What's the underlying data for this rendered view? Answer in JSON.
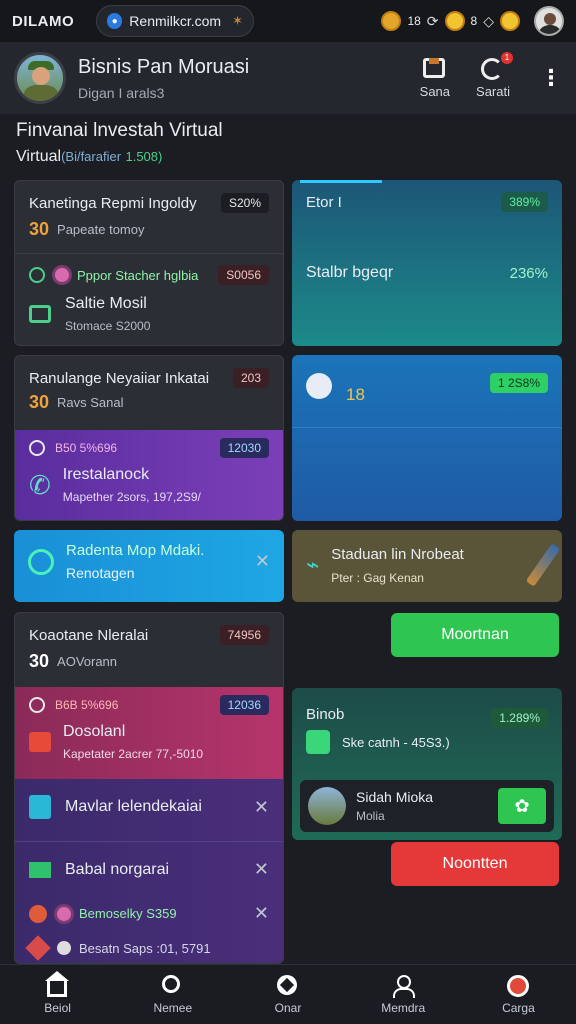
{
  "status_bar": {
    "time": "DILAMO",
    "url": "Renmilkcr.com",
    "right_text_1": "18",
    "right_text_2": "8",
    "icons": [
      "globe-icon",
      "star-icon",
      "coin-icon",
      "refresh-icon",
      "coin-icon",
      "diamond-icon",
      "coin-icon",
      "avatar"
    ]
  },
  "header": {
    "title": "Bisnis Pan Moruasi",
    "subtitle": "Digan I arals3",
    "actions": [
      {
        "label": "Sana",
        "icon": "save-icon"
      },
      {
        "label": "Sarati",
        "icon": "sync-icon",
        "badge": "1"
      }
    ]
  },
  "section": {
    "title": "Finvanai lnvestah Virtual",
    "sub_main": "Virtual",
    "sub_muted": "(Bi/farafier",
    "sub_green": "1.508)"
  },
  "left_cards": [
    {
      "title": "Kanetinga Repmi Ingoldy",
      "tag": "S20%",
      "amount_icon": "30",
      "amount_label": "Papeate tomoy",
      "item_line": "Pppor Stacher hglbia",
      "item_tag": "S0056",
      "item_title": "Saltie Mosil",
      "item_sub": "Stomace S2000"
    },
    {
      "title": "Ranulange Neyaiiar Inkatai",
      "tag": "203",
      "amount_icon": "30",
      "amount_label": "Ravs Sanal",
      "purple_line": "B50 5%696",
      "purple_tag": "12030",
      "purple_title": "Irestalanock",
      "purple_sub": "Mapether 2sors, 197,2S9/"
    },
    {
      "title": "Radenta Mop Mdaki.",
      "sub": "Renotagen"
    },
    {
      "title": "Koaotane Nleralai",
      "tag": "74956",
      "amount_icon": "30",
      "amount_label": "AOVorann",
      "magenta_line": "B6B 5%696",
      "magenta_tag": "12036",
      "magenta_title": "Dosolanl",
      "magenta_sub": "Kapetater 2acrer 77,-5010"
    },
    {
      "title": "Mavlar lelendekaiai"
    },
    {
      "title": "Babal norgarai"
    },
    {
      "title": "Bemoselky S359"
    },
    {
      "title": "Besatn Saps :01, 5791"
    }
  ],
  "right_cards": [
    {
      "title": "Etor I",
      "tag": "389%",
      "sub_title": "Stalbr bgeqr",
      "sub_tag": "236%"
    },
    {
      "value": "18",
      "tag": "1 2S8%"
    },
    {
      "title": "Staduan lin Nrobeat",
      "sub": "Pter : Gag Kenan"
    },
    {
      "btn": "Moortnan"
    },
    {
      "title": "Binob",
      "tag": "1.289%",
      "line": "Ske catnh - 45S3.)",
      "mini_title": "Sidah Mioka",
      "mini_sub": "Molia"
    },
    {
      "btn": "Noontten"
    }
  ],
  "nav": [
    {
      "label": "Beiol",
      "icon": "home-icon"
    },
    {
      "label": "Nemee",
      "icon": "search-icon"
    },
    {
      "label": "Onar",
      "icon": "compass-icon"
    },
    {
      "label": "Memdra",
      "icon": "user-icon"
    },
    {
      "label": "Carga",
      "icon": "cart-icon"
    }
  ]
}
